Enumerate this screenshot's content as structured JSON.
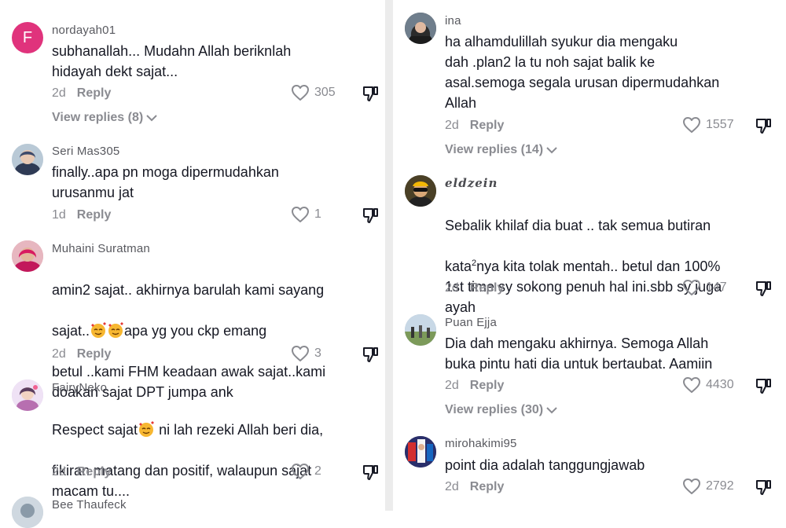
{
  "left": {
    "comments": [
      {
        "user": "nordayah01",
        "avatar_letter": "F",
        "text": "subhanallah... Mudahn Allah beriknlah\nhidayah dekt sajat...",
        "time": "2d",
        "reply": "Reply",
        "likes": "305",
        "view_replies": "View replies (8)"
      },
      {
        "user": "Seri Mas305",
        "text": "finally..apa pn moga dipermudahkan\nurusanmu jat",
        "time": "1d",
        "reply": "Reply",
        "likes": "1"
      },
      {
        "user": "Muhaini Suratman",
        "text_a": "amin2 sajat.. akhirnya barulah kami sayang",
        "text_b": "sajat..",
        "text_c": "apa yg you ckp emang",
        "text_d": "betul ..kami FHM keadaan awak sajat..kami\ndoakan sajat DPT jumpa ank",
        "time": "2d",
        "reply": "Reply",
        "likes": "3"
      },
      {
        "user": "FairyNeko",
        "text_a": "Respect sajat",
        "text_b": " ni lah rezeki Allah beri dia,",
        "text_c": "fikiran matang dan positif, walaupun sajat\nmacam tu....",
        "time": "2d",
        "reply": "Reply",
        "likes": "2"
      },
      {
        "user": "Bee Thaufeck"
      }
    ]
  },
  "right": {
    "comments": [
      {
        "user": "ina",
        "text": "ha alhamdulillah syukur dia mengaku\ndah .plan2 la tu noh sajat balik ke\nasal.semoga segala urusan dipermudahkan\nAllah",
        "time": "2d",
        "reply": "Reply",
        "likes": "1557",
        "view_replies": "View replies (14)"
      },
      {
        "user": "eldzein",
        "text_a": "Sebalik khilaf dia buat .. tak semua butiran",
        "text_b": "kata",
        "text_sup": "2",
        "text_c": "nya kita tolak mentah.. betul dan 100%\n1st time sy sokong penuh hal ini.sbb sy juga\nayah",
        "time": "2d",
        "reply": "Reply",
        "likes": "147"
      },
      {
        "user": "Puan Ejja",
        "text": "Dia dah mengaku akhirnya. Semoga Allah\nbuka pintu hati dia untuk bertaubat. Aamiin",
        "time": "2d",
        "reply": "Reply",
        "likes": "4430",
        "view_replies": "View replies (30)"
      },
      {
        "user": "mirohakimi95",
        "text": "point dia adalah tanggungjawab",
        "time": "2d",
        "reply": "Reply",
        "likes": "2792"
      }
    ]
  },
  "colors": {
    "avatar_pink": "#e0337c",
    "muted": "#8a8b91",
    "text": "#161823",
    "username": "#58595f"
  },
  "icons": {
    "like": "heart-outline-icon",
    "dislike": "thumbs-down-icon",
    "expand": "chevron-down-icon",
    "emoji": "smiling-face-with-hearts-emoji"
  }
}
